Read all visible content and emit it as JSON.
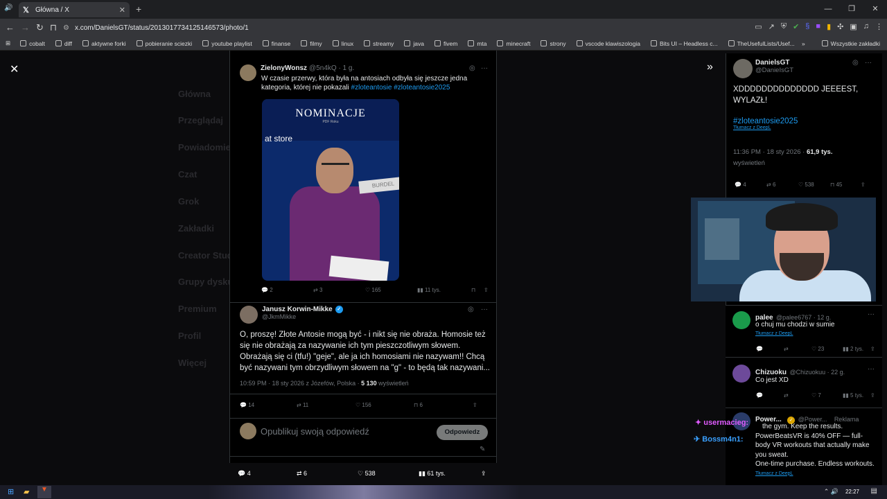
{
  "browser": {
    "tab_title": "Główna / X",
    "url": "x.com/DanielsGT/status/2013017734125146573/photo/1",
    "bookmarks": [
      "cobalt",
      "diff",
      "aktywne forki",
      "pobieranie sciezki",
      "youtube playlist",
      "finanse",
      "filmy",
      "linux",
      "streamy",
      "java",
      "fivem",
      "mta",
      "minecraft",
      "strony",
      "vscode klawiszologia",
      "Bits UI – Headless c...",
      "TheUsefulLists/Usef..."
    ],
    "bookmarks_all": "Wszystkie zakładki"
  },
  "background_nav": [
    "Główna",
    "Przeglądaj",
    "Powiadomienia",
    "Czat",
    "Grok",
    "Zakładki",
    "Creator Studio",
    "Grupy dyskusyjne",
    "Premium",
    "Profil",
    "Więcej"
  ],
  "tweet1": {
    "name": "ZielonyWonsz",
    "handle": "@5n4kQ · 1 g.",
    "text": "W czasie przerwy, która była na antosiach odbyła się jeszcze jedna kategoria, której nie pokazali",
    "tags": "#zloteantosie #zloteantosie2025",
    "media_title": "NOMINACJE",
    "media_sub": "PDF Roku",
    "media_logo": "at store",
    "media_card": "BURDEL",
    "replies": "2",
    "reposts": "3",
    "likes": "165",
    "views": "11 tys."
  },
  "tweet2": {
    "name": "Janusz Korwin-Mikke",
    "handle": "@JkmMikke",
    "text": "O, proszę! Złote Antosie mogą być - i nikt się nie obraża. Homosie też się nie obrażają za nazywanie ich tym pieszczotliwym słowem. Obrażają się ci (tfu!) \"geje\", ale ja ich homosiami nie nazywam!! Chcą być nazywani tym obrzydliwym słowem na \"g\" - to będą tak nazywani...",
    "meta": "10:59 PM · 18 sty 2026 z Józefów, Polska · ",
    "views_count": "5 130",
    "views_label": "wyświetleń",
    "replies": "14",
    "reposts": "11",
    "likes": "156",
    "bookmarks": "6",
    "reply_placeholder": "Opublikuj swoją odpowiedź",
    "reply_button": "Odpowiedz"
  },
  "bottom_bar": {
    "replies": "4",
    "reposts": "6",
    "likes": "538",
    "views": "61 tys."
  },
  "right_post": {
    "name": "DanielsGT",
    "handle": "@DanieIsGT",
    "text": "XDDDDDDDDDDDDDD JEEEEST, WYLAZŁ!",
    "tag": "#zloteantosie2025",
    "translate": "Tłumacz z DeepL",
    "time": "11:36 PM · 18 sty 2026 · ",
    "views": "61,9 tys.",
    "views_label": "wyświetleń",
    "replies": "4",
    "reposts": "6",
    "likes": "538",
    "bookmarks": "45"
  },
  "comments": [
    {
      "name": "palee",
      "handle": "@palee6767 · 12 g.",
      "text": "o chuj mu chodzi w sumie",
      "translate": "Tłumacz z DeepL",
      "likes": "23",
      "views": "2 tys."
    },
    {
      "name": "Chizuoku",
      "handle": "@Chizuokuu · 22 g.",
      "text": "Co jest XD",
      "translate": "",
      "likes": "7",
      "views": "5 tys."
    },
    {
      "name": "Power...",
      "handle": "@Power...",
      "ad": "Reklama",
      "text1": "the gym. Keep the results.",
      "text2": "PowerBeatsVR is 40% OFF — full-body VR workouts that actually make you sweat.",
      "text3": "One-time purchase. Endless workouts.",
      "translate": "Tłumacz z DeepL"
    }
  ],
  "chat": [
    {
      "user": "usermacieg:",
      "color": "#e05cff"
    },
    {
      "user": "Bossm4n1:",
      "color": "#3aa0ff"
    }
  ],
  "taskbar": {
    "time": "22:27"
  }
}
